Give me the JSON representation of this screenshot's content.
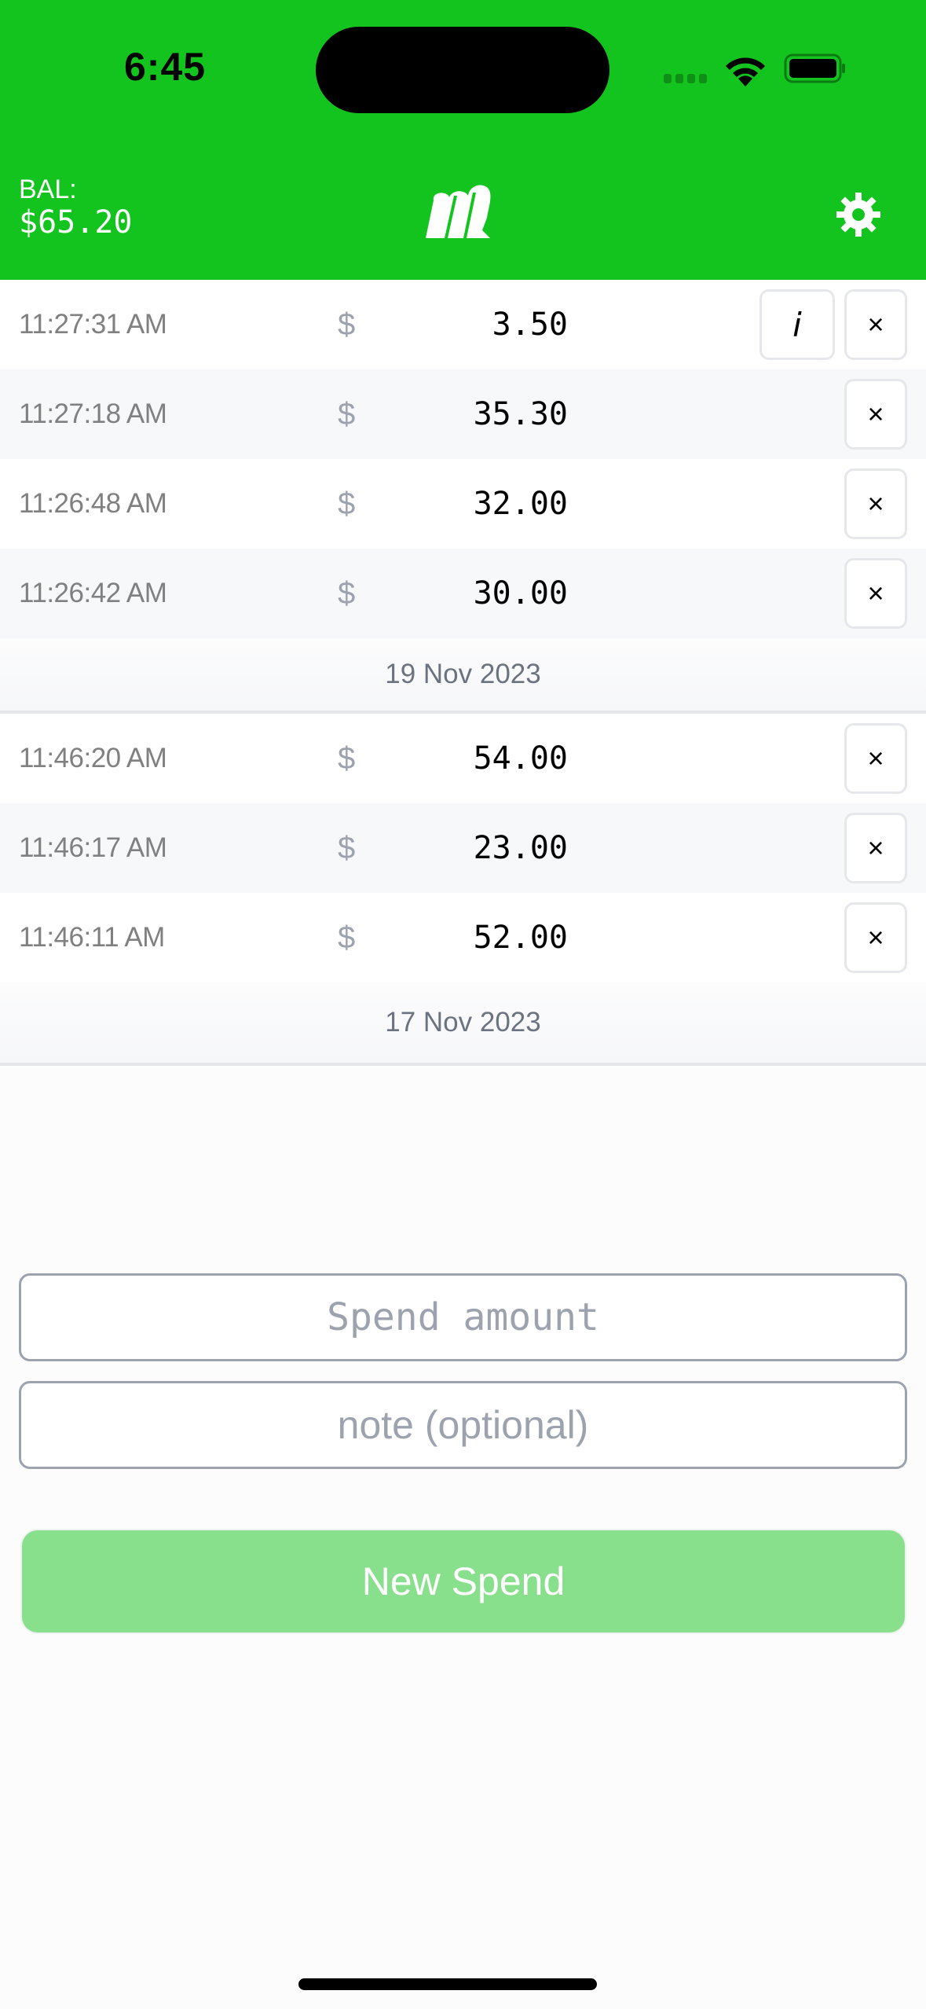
{
  "status_bar": {
    "time": "6:45"
  },
  "header": {
    "balance_label": "BAL:",
    "balance_value": "$65.20",
    "logo": "m-logo",
    "settings_icon": "gear-icon"
  },
  "colors": {
    "brand": "#14c41e",
    "button_disabled": "#89e08c",
    "muted": "#9ca3af"
  },
  "spends_group_1": [
    {
      "time": "11:27:31 AM",
      "currency": "$",
      "amount": "3.50",
      "has_note": true,
      "info_label": "i",
      "delete_label": "×"
    },
    {
      "time": "11:27:18 AM",
      "currency": "$",
      "amount": "35.30",
      "has_note": false,
      "delete_label": "×"
    },
    {
      "time": "11:26:48 AM",
      "currency": "$",
      "amount": "32.00",
      "has_note": false,
      "delete_label": "×"
    },
    {
      "time": "11:26:42 AM",
      "currency": "$",
      "amount": "30.00",
      "has_note": false,
      "delete_label": "×"
    }
  ],
  "date_1": "19 Nov 2023",
  "spends_group_2": [
    {
      "time": "11:46:20 AM",
      "currency": "$",
      "amount": "54.00",
      "delete_label": "×"
    },
    {
      "time": "11:46:17 AM",
      "currency": "$",
      "amount": "23.00",
      "delete_label": "×"
    },
    {
      "time": "11:46:11 AM",
      "currency": "$",
      "amount": "52.00",
      "delete_label": "×"
    }
  ],
  "date_2": "17 Nov 2023",
  "form": {
    "amount_placeholder": "Spend amount",
    "amount_value": "",
    "note_placeholder": "note (optional)",
    "note_value": "",
    "submit_label": "New Spend"
  }
}
